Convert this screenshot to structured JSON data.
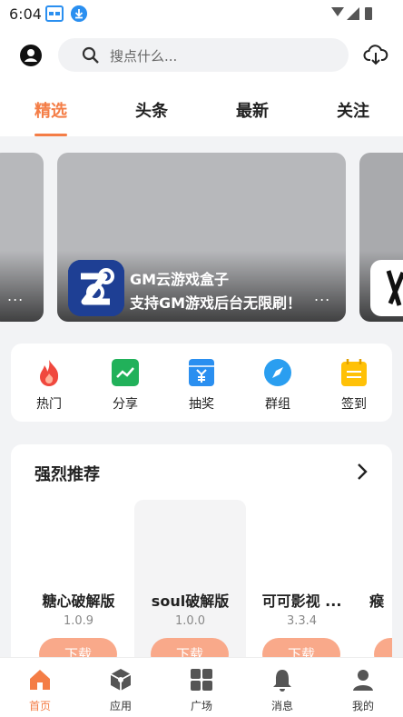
{
  "status": {
    "time": "6:04"
  },
  "search": {
    "placeholder": "搜点什么..."
  },
  "tabs": [
    {
      "label": "精选",
      "active": true
    },
    {
      "label": "头条"
    },
    {
      "label": "最新"
    },
    {
      "label": "关注"
    }
  ],
  "banner": {
    "left_more": "...",
    "main": {
      "line1": "GM云游戏盒子",
      "line2": "支持GM游戏后台无限刷！",
      "more": "..."
    }
  },
  "quick_actions": [
    {
      "label": "热门",
      "icon": "flame-icon"
    },
    {
      "label": "分享",
      "icon": "chart-icon"
    },
    {
      "label": "抽奖",
      "icon": "lottery-icon"
    },
    {
      "label": "群组",
      "icon": "compass-icon"
    },
    {
      "label": "签到",
      "icon": "calendar-icon"
    }
  ],
  "recommend": {
    "title": "强烈推荐",
    "cards": [
      {
        "name": "糖心破解版",
        "version": "1.0.9",
        "button": "下载"
      },
      {
        "name": "soul破解版",
        "version": "1.0.0",
        "button": "下载"
      },
      {
        "name": "可可影视 ...",
        "version": "3.3.4",
        "button": "下载"
      },
      {
        "name": "瘊",
        "version": "",
        "button": "下"
      }
    ]
  },
  "nav": [
    {
      "label": "首页",
      "icon": "home-icon",
      "active": true
    },
    {
      "label": "应用",
      "icon": "cube-icon"
    },
    {
      "label": "广场",
      "icon": "grid-icon"
    },
    {
      "label": "消息",
      "icon": "bell-icon"
    },
    {
      "label": "我的",
      "icon": "user-icon"
    }
  ],
  "colors": {
    "accent": "#f47d46",
    "download_button": "#f9a98a",
    "background": "#f2f3f5"
  }
}
